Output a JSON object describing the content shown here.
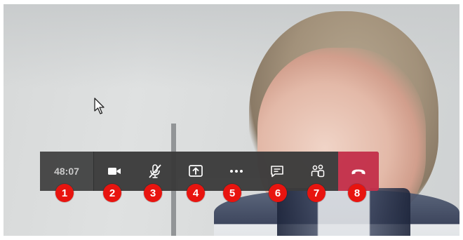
{
  "call": {
    "timer": "48:07"
  },
  "toolbar": {
    "buttons": [
      {
        "icon": "video-camera-icon"
      },
      {
        "icon": "microphone-muted-icon"
      },
      {
        "icon": "share-screen-icon"
      },
      {
        "icon": "more-options-icon"
      },
      {
        "icon": "chat-icon"
      },
      {
        "icon": "participants-icon"
      },
      {
        "icon": "hang-up-icon"
      }
    ]
  },
  "badges": [
    "1",
    "2",
    "3",
    "4",
    "5",
    "6",
    "7",
    "8"
  ],
  "colors": {
    "toolbar_bg": "#3b3b3b",
    "hangup": "#c4314b",
    "badge": "#e8140f",
    "icon": "#ffffff"
  }
}
